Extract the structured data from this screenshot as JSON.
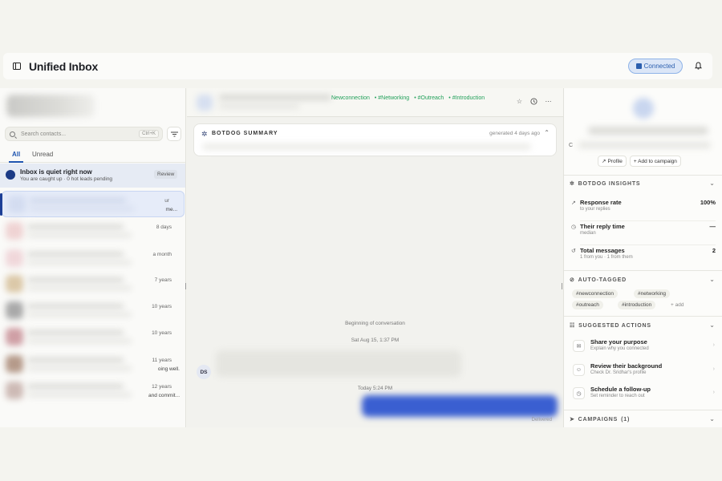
{
  "header": {
    "title": "Unified Inbox",
    "connected_label": "Connected"
  },
  "left": {
    "search_placeholder": "Search contacts...",
    "search_shortcut": "Ctrl+K",
    "tabs": [
      {
        "label": "All"
      },
      {
        "label": "Unread"
      }
    ],
    "quiet": {
      "title": "Inbox is quiet right now",
      "subtitle": "You are caught up · 0 hot leads pending",
      "review_label": "Review"
    },
    "conversations": [
      {
        "time": "ur",
        "snippet": "me..."
      },
      {
        "time": "8 days",
        "snippet": ""
      },
      {
        "time": "a month",
        "snippet": ""
      },
      {
        "time": "7 years",
        "snippet": ""
      },
      {
        "time": "10 years",
        "snippet": ""
      },
      {
        "time": "10 years",
        "snippet": ""
      },
      {
        "time": "11 years",
        "snippet": "oing well."
      },
      {
        "time": "12 years",
        "snippet": "and commit..."
      }
    ]
  },
  "middle": {
    "tags": [
      "Newconnection",
      "#Networking",
      "#Outreach",
      "#Introduction"
    ],
    "summary_title": "BOTDOG SUMMARY",
    "summary_meta": "generated 4 days ago",
    "beginning": "Beginning of conversation",
    "date1": "Sat Aug 15, 1:37 PM",
    "sender_initials": "DS",
    "date2": "Today 5:24 PM",
    "delivered": "Delivered"
  },
  "right": {
    "profile_initial": "C",
    "profile_button": "Profile",
    "add_campaign_button": "+ Add to campaign",
    "insights_title": "BOTDOG INSIGHTS",
    "insights": [
      {
        "label": "Response rate",
        "sub": "to your replies",
        "value": "100%"
      },
      {
        "label": "Their reply time",
        "sub": "median",
        "value": "—"
      },
      {
        "label": "Total messages",
        "sub": "1 from you · 1 from them",
        "value": "2"
      }
    ],
    "autotag_title": "AUTO-TAGGED",
    "auto_tags": [
      "#newconnection",
      "#networking",
      "#outreach",
      "#introduction"
    ],
    "add_tag_label": "+ add",
    "actions_title": "SUGGESTED ACTIONS",
    "actions": [
      {
        "label": "Share your purpose",
        "sub": "Explain why you connected"
      },
      {
        "label": "Review their background",
        "sub": "Check Dr. Sridhar's profile"
      },
      {
        "label": "Schedule a follow-up",
        "sub": "Set reminder to reach out"
      }
    ],
    "campaigns_title": "CAMPAIGNS",
    "campaigns_count": "(1)"
  },
  "colors": {
    "accent": "#1f55b0",
    "tag_green": "#22a05a",
    "outgoing_bubble": "#3a5fd1"
  }
}
